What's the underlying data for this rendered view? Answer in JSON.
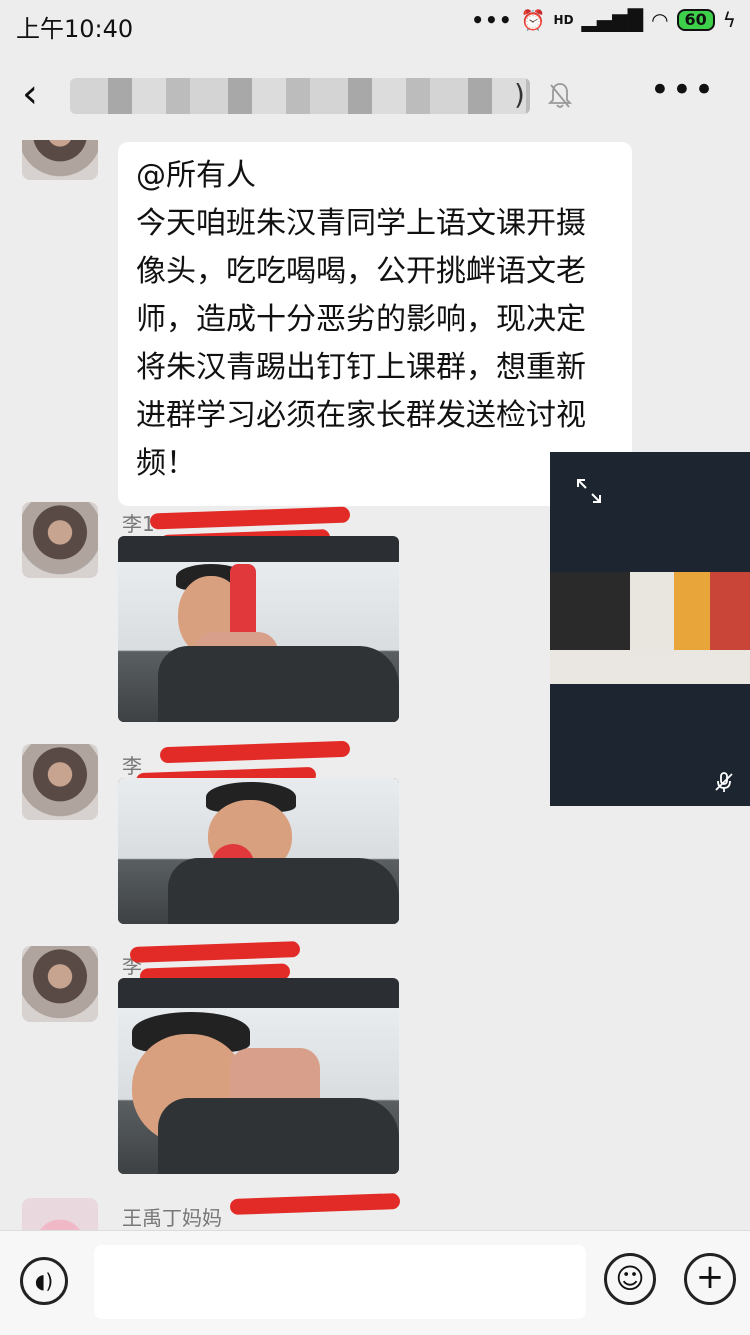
{
  "status_bar": {
    "time": "上午10:40",
    "signal_label": "HD",
    "battery": "60"
  },
  "nav": {
    "title_suffix": ")"
  },
  "messages": {
    "announcement": {
      "mention": "@所有人",
      "text": "今天咱班朱汉青同学上语文课开摄像头，吃吃喝喝，公开挑衅语文老师，造成十分恶劣的影响，现决定将朱汉青踢出钉钉上课群，想重新进群学习必须在家长群发送检讨视频！"
    },
    "sender_1": "李1",
    "sender_2": "李",
    "sender_3": "李",
    "sender_4": "王禹丁妈妈"
  },
  "icons": [
    "back-icon",
    "mute-icon",
    "more-icon",
    "expand-icon",
    "mic-off-icon",
    "voice-icon",
    "emoji-icon",
    "plus-icon"
  ]
}
